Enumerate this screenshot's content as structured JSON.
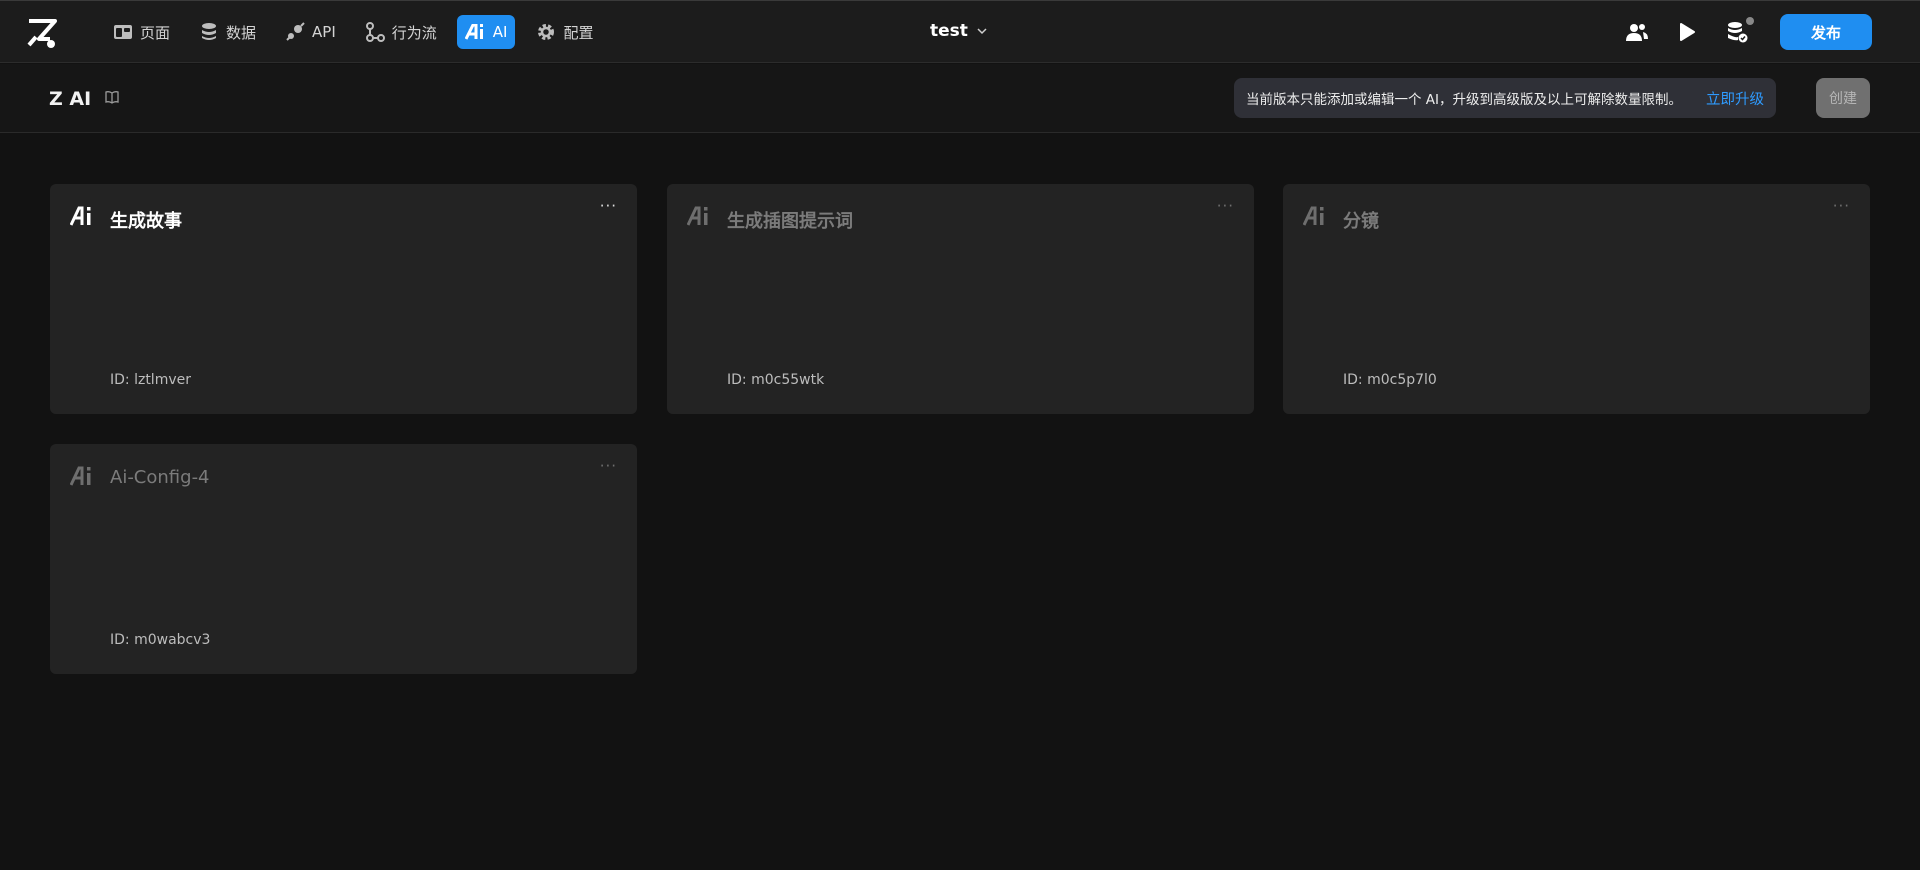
{
  "topbar": {
    "nav": [
      {
        "label": "页面",
        "icon": "page-icon"
      },
      {
        "label": "数据",
        "icon": "database-icon"
      },
      {
        "label": "API",
        "icon": "api-icon"
      },
      {
        "label": "行为流",
        "icon": "flow-icon"
      },
      {
        "label": "AI",
        "icon": "ai-icon",
        "active": true
      },
      {
        "label": "配置",
        "icon": "gear-icon"
      }
    ],
    "project_name": "test",
    "publish_label": "发布"
  },
  "subheader": {
    "title": "Z AI",
    "notice_text": "当前版本只能添加或编辑一个 AI，升级到高级版及以上可解除数量限制。",
    "upgrade_label": "立即升级",
    "create_label": "创建"
  },
  "cards": [
    {
      "title": "生成故事",
      "id_text": "ID: lztlmver",
      "state": "primary"
    },
    {
      "title": "生成插图提示词",
      "id_text": "ID: m0c55wtk",
      "state": "disabled"
    },
    {
      "title": "分镜",
      "id_text": "ID: m0c5p7l0",
      "state": "disabled"
    },
    {
      "title": "Ai-Config-4",
      "id_text": "ID: m0wabcv3",
      "state": "disabled"
    }
  ],
  "colors": {
    "accent": "#1f8ef1",
    "background": "#121212",
    "card": "#232323",
    "link": "#2f9bff"
  }
}
